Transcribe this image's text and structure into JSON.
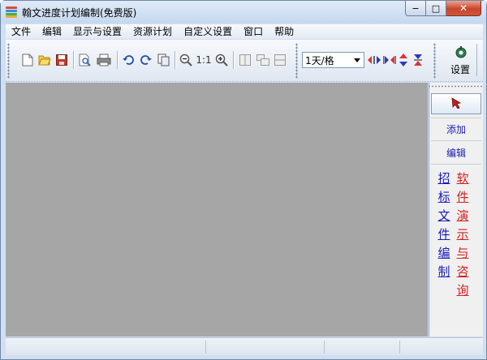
{
  "window": {
    "title": "翰文进度计划编制(免费版)",
    "controls": {
      "minimize": "−",
      "maximize": "□",
      "close": "✕"
    }
  },
  "menu": [
    "文件",
    "编辑",
    "显示与设置",
    "资源计划",
    "自定义设置",
    "窗口",
    "帮助"
  ],
  "toolbar": {
    "icons": [
      "new-file-icon",
      "open-folder-icon",
      "save-icon",
      "print-preview-icon",
      "print-icon",
      "undo-icon",
      "redo-icon",
      "copy-icon",
      "zoom-out-icon",
      "zoom-in-icon",
      "split-view-icon",
      "cascade-icon",
      "tile-icon",
      "expand-horizontal-icon",
      "collapse-horizontal-icon",
      "expand-vertical-icon",
      "collapse-vertical-icon",
      "settings-icon"
    ],
    "zoom_reset": "1:1",
    "scale_value": "1天/格",
    "settings_label": "设置"
  },
  "panel": {
    "add": "添加",
    "edit": "编辑",
    "link_bidding": "招标文件编制",
    "link_demo": "软件演示与咨询"
  },
  "colors": {
    "canvas": "#a6a6a6",
    "link_blue": "#1a1ab8",
    "link_red": "#d42020"
  }
}
